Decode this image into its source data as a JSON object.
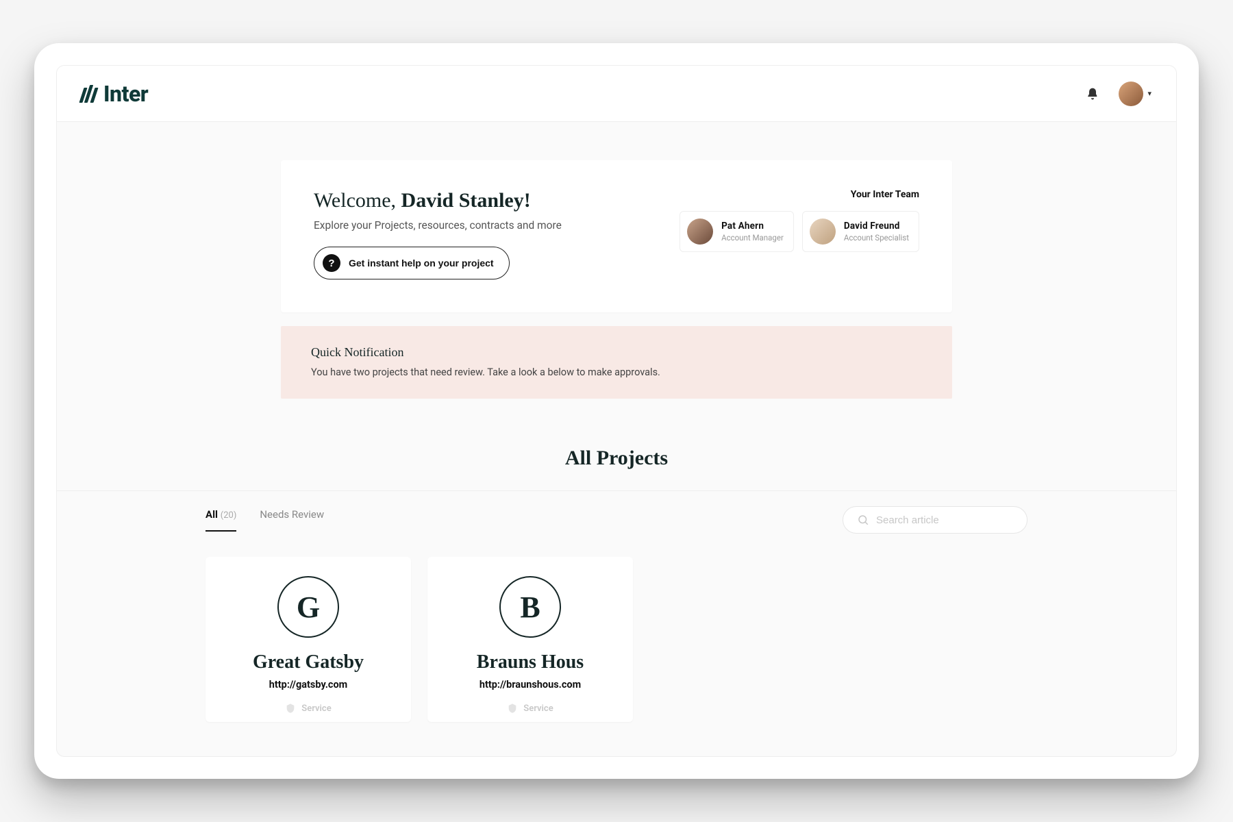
{
  "brand": "Inter",
  "welcome": {
    "prefix": "Welcome, ",
    "name": "David Stanley!",
    "subtitle": "Explore your Projects, resources, contracts and more",
    "help_label": "Get instant help on your project"
  },
  "team": {
    "label": "Your Inter Team",
    "members": [
      {
        "name": "Pat Ahern",
        "role": "Account Manager"
      },
      {
        "name": "David Freund",
        "role": "Account Specialist"
      }
    ]
  },
  "notification": {
    "title": "Quick Notification",
    "text": "You have two projects that need review. Take a look a below to make approvals."
  },
  "projects": {
    "section_title": "All Projects",
    "tabs": {
      "all_label": "All",
      "all_count": "(20)",
      "review_label": "Needs Review"
    },
    "search_placeholder": "Search article",
    "cards": [
      {
        "initial": "G",
        "name": "Great Gatsby",
        "url": "http://gatsby.com",
        "service": "Service"
      },
      {
        "initial": "B",
        "name": "Brauns Hous",
        "url": "http://braunshous.com",
        "service": "Service"
      }
    ]
  }
}
